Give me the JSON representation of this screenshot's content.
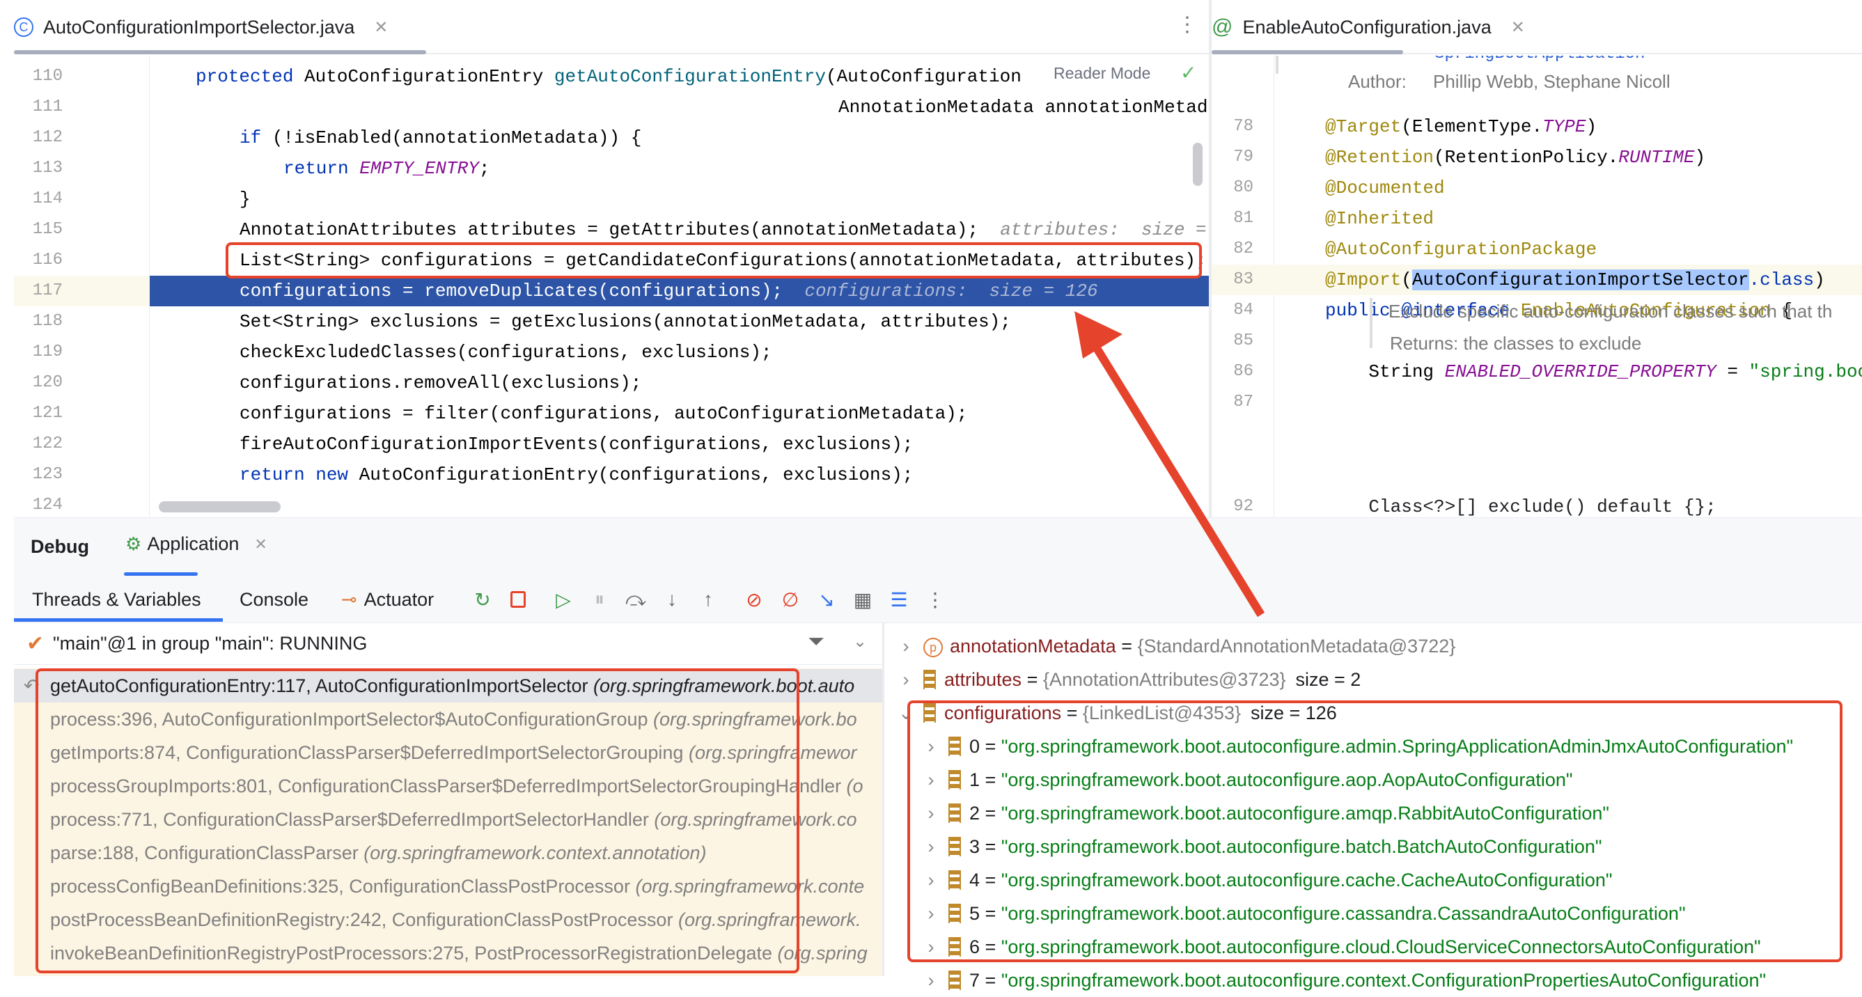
{
  "left_editor": {
    "tab_title": "AutoConfigurationImportSelector.java",
    "tab_icon": "class-icon",
    "reader_mode": "Reader Mode",
    "lines": [
      {
        "n": "110",
        "tokens": [
          [
            "protected ",
            "kw"
          ],
          [
            "AutoConfigurationEntry ",
            "cls"
          ],
          [
            "getAutoConfigurationEntry",
            "fn"
          ],
          [
            "(AutoConfiguration",
            "cls"
          ]
        ],
        "indent": 0
      },
      {
        "n": "111",
        "tokens": [
          [
            "AnnotationMetadata annotationMetad",
            "cls"
          ]
        ],
        "indent": -1
      },
      {
        "n": "112",
        "tokens": [
          [
            "if ",
            "kw"
          ],
          [
            "(!isEnabled(annotationMetadata)) {",
            "cls"
          ]
        ],
        "indent": 1
      },
      {
        "n": "113",
        "tokens": [
          [
            "return ",
            "kw"
          ],
          [
            "EMPTY_ENTRY",
            "const"
          ],
          [
            ";",
            "cls"
          ]
        ],
        "indent": 2
      },
      {
        "n": "114",
        "tokens": [
          [
            "}",
            "cls"
          ]
        ],
        "indent": 1
      },
      {
        "n": "115",
        "tokens": [
          [
            "AnnotationAttributes attributes = getAttributes(annotationMetadata);  ",
            "cls"
          ],
          [
            "attributes:  size =",
            "hint"
          ]
        ],
        "indent": 1
      },
      {
        "n": "116",
        "tokens": [
          [
            "List<String> configurations = getCandidateConfigurations(annotationMetadata, attributes);",
            "cls"
          ]
        ],
        "indent": 1
      },
      {
        "n": "117",
        "tokens": [
          [
            "configurations = removeDuplicates(configurations);  ",
            "cls"
          ],
          [
            "configurations:  size = 126",
            "hint"
          ]
        ],
        "indent": 1,
        "current": true
      },
      {
        "n": "118",
        "tokens": [
          [
            "Set<String> exclusions = getExclusions(annotationMetadata, attributes);",
            "cls"
          ]
        ],
        "indent": 1
      },
      {
        "n": "119",
        "tokens": [
          [
            "checkExcludedClasses(configurations, exclusions);",
            "cls"
          ]
        ],
        "indent": 1
      },
      {
        "n": "120",
        "tokens": [
          [
            "configurations.removeAll(exclusions);",
            "cls"
          ]
        ],
        "indent": 1
      },
      {
        "n": "121",
        "tokens": [
          [
            "configurations = filter(configurations, autoConfigurationMetadata);",
            "cls"
          ]
        ],
        "indent": 1
      },
      {
        "n": "122",
        "tokens": [
          [
            "fireAutoConfigurationImportEvents(configurations, exclusions);",
            "cls"
          ]
        ],
        "indent": 1
      },
      {
        "n": "123",
        "tokens": [
          [
            "return new ",
            "kw"
          ],
          [
            "AutoConfigurationEntry(configurations, exclusions);",
            "cls"
          ]
        ],
        "indent": 1
      },
      {
        "n": "124",
        "tokens": [],
        "indent": 1
      }
    ]
  },
  "right_editor": {
    "tab_title": "EnableAutoConfiguration.java",
    "tab_icon": "annotation-icon",
    "doc_top": "SpringBootApplication",
    "author_label": "Author:",
    "author_value": "Phillip Webb, Stephane Nicoll",
    "lines": [
      {
        "n": "78",
        "tokens": [
          [
            "@Target",
            "ann"
          ],
          [
            "(ElementType.",
            "cls"
          ],
          [
            "TYPE",
            "const"
          ],
          [
            ")",
            "cls"
          ]
        ]
      },
      {
        "n": "79",
        "tokens": [
          [
            "@Retention",
            "ann"
          ],
          [
            "(RetentionPolicy.",
            "cls"
          ],
          [
            "RUNTIME",
            "const"
          ],
          [
            ")",
            "cls"
          ]
        ]
      },
      {
        "n": "80",
        "tokens": [
          [
            "@Documented",
            "ann"
          ]
        ]
      },
      {
        "n": "81",
        "tokens": [
          [
            "@Inherited",
            "ann"
          ]
        ]
      },
      {
        "n": "82",
        "tokens": [
          [
            "@AutoConfigurationPackage",
            "ann"
          ]
        ]
      },
      {
        "n": "83",
        "tokens": [
          [
            "@Import",
            "ann"
          ],
          [
            "(",
            "cls"
          ],
          [
            "AutoConfigurationImportSelector",
            "selword"
          ],
          [
            ".class",
            "kw"
          ],
          [
            ")",
            "cls"
          ]
        ],
        "current": true
      },
      {
        "n": "84",
        "tokens": [
          [
            "public @interface ",
            "kw"
          ],
          [
            "EnableAutoConfiguration ",
            "ann"
          ],
          [
            "{",
            "cls"
          ]
        ]
      },
      {
        "n": "85",
        "tokens": []
      },
      {
        "n": "86",
        "tokens": [
          [
            "    String ",
            "cls"
          ],
          [
            "ENABLED_OVERRIDE_PROPERTY",
            "const"
          ],
          [
            " = ",
            "cls"
          ],
          [
            "\"spring.boo",
            "str"
          ]
        ]
      },
      {
        "n": "87",
        "tokens": []
      }
    ],
    "doc_exclude": "Exclude specific auto-configuration classes such that th",
    "doc_returns": "Returns: the classes to exclude",
    "last_line_n": "92",
    "last_line": "    Class<?>[] exclude() default {};"
  },
  "debug": {
    "title": "Debug",
    "session_tab": "Application",
    "tabs": [
      "Threads & Variables",
      "Console",
      "Actuator"
    ],
    "thread": "\"main\"@1 in group \"main\": RUNNING",
    "frames": [
      {
        "method": "getAutoConfigurationEntry:117, AutoConfigurationImportSelector ",
        "pkg": "(org.springframework.boot.auto",
        "current": true
      },
      {
        "method": "process:396, AutoConfigurationImportSelector$AutoConfigurationGroup ",
        "pkg": "(org.springframework.bo"
      },
      {
        "method": "getImports:874, ConfigurationClassParser$DeferredImportSelectorGrouping ",
        "pkg": "(org.springframewor"
      },
      {
        "method": "processGroupImports:801, ConfigurationClassParser$DeferredImportSelectorGroupingHandler ",
        "pkg": "(o"
      },
      {
        "method": "process:771, ConfigurationClassParser$DeferredImportSelectorHandler ",
        "pkg": "(org.springframework.co"
      },
      {
        "method": "parse:188, ConfigurationClassParser ",
        "pkg": "(org.springframework.context.annotation)"
      },
      {
        "method": "processConfigBeanDefinitions:325, ConfigurationClassPostProcessor ",
        "pkg": "(org.springframework.conte"
      },
      {
        "method": "postProcessBeanDefinitionRegistry:242, ConfigurationClassPostProcessor ",
        "pkg": "(org.springframework."
      },
      {
        "method": "invokeBeanDefinitionRegistryPostProcessors:275, PostProcessorRegistrationDelegate ",
        "pkg": "(org.spring"
      }
    ],
    "variables": [
      {
        "name": "annotationMetadata",
        "value": "{StandardAnnotationMetadata@3722}",
        "extra": "",
        "icon": "parameter-icon",
        "level": 0
      },
      {
        "name": "attributes",
        "value": "{AnnotationAttributes@3723}",
        "extra": "size = 2",
        "icon": "list-icon",
        "level": 0
      },
      {
        "name": "configurations",
        "value": "{LinkedList@4353}",
        "extra": "size = 126",
        "icon": "list-icon",
        "level": 0,
        "expanded": true
      },
      {
        "name": "0",
        "str": "\"org.springframework.boot.autoconfigure.admin.SpringApplicationAdminJmxAutoConfiguration\"",
        "level": 1
      },
      {
        "name": "1",
        "str": "\"org.springframework.boot.autoconfigure.aop.AopAutoConfiguration\"",
        "level": 1
      },
      {
        "name": "2",
        "str": "\"org.springframework.boot.autoconfigure.amqp.RabbitAutoConfiguration\"",
        "level": 1
      },
      {
        "name": "3",
        "str": "\"org.springframework.boot.autoconfigure.batch.BatchAutoConfiguration\"",
        "level": 1
      },
      {
        "name": "4",
        "str": "\"org.springframework.boot.autoconfigure.cache.CacheAutoConfiguration\"",
        "level": 1
      },
      {
        "name": "5",
        "str": "\"org.springframework.boot.autoconfigure.cassandra.CassandraAutoConfiguration\"",
        "level": 1
      },
      {
        "name": "6",
        "str": "\"org.springframework.boot.autoconfigure.cloud.CloudServiceConnectorsAutoConfiguration\"",
        "level": 1
      },
      {
        "name": "7",
        "str": "\"org.springframework.boot.autoconfigure.context.ConfigurationPropertiesAutoConfiguration\"",
        "level": 1
      }
    ]
  },
  "colors": {
    "accent": "#3574f0",
    "current_line": "#2d54a6",
    "annotation_red": "#e5432b",
    "string": "#067d17"
  }
}
